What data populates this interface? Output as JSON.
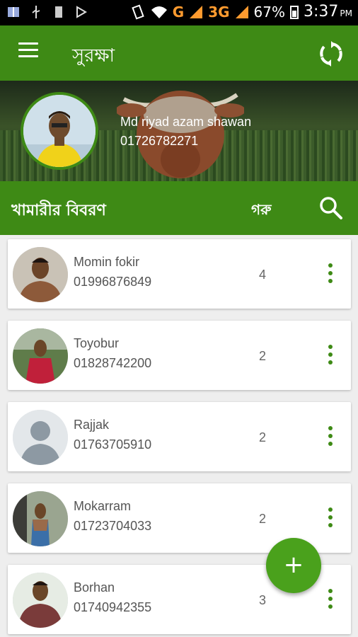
{
  "status_bar": {
    "network_g": "G",
    "network_3g": "3G",
    "battery": "67%",
    "time": "3:37",
    "ampm": "PM"
  },
  "app_bar": {
    "title": "সুরক্ষা",
    "menu_icon": "menu-icon",
    "sync_icon": "sync-icon"
  },
  "profile": {
    "name": "Md riyad azam shawan",
    "phone": "01726782271"
  },
  "section": {
    "title": "খামারীর বিবরণ",
    "count_label": "গরু",
    "search_icon": "search-icon"
  },
  "farmers": [
    {
      "name": "Momin fokir",
      "phone": "01996876849",
      "count": "4"
    },
    {
      "name": "Toyobur",
      "phone": "01828742200",
      "count": "2"
    },
    {
      "name": "Rajjak",
      "phone": "01763705910",
      "count": "2"
    },
    {
      "name": "Mokarram",
      "phone": "01723704033",
      "count": "2"
    },
    {
      "name": "Borhan",
      "phone": "01740942355",
      "count": "3"
    }
  ],
  "fab": {
    "label": "+"
  },
  "colors": {
    "primary": "#3e8a15",
    "fab": "#4aa11c"
  }
}
